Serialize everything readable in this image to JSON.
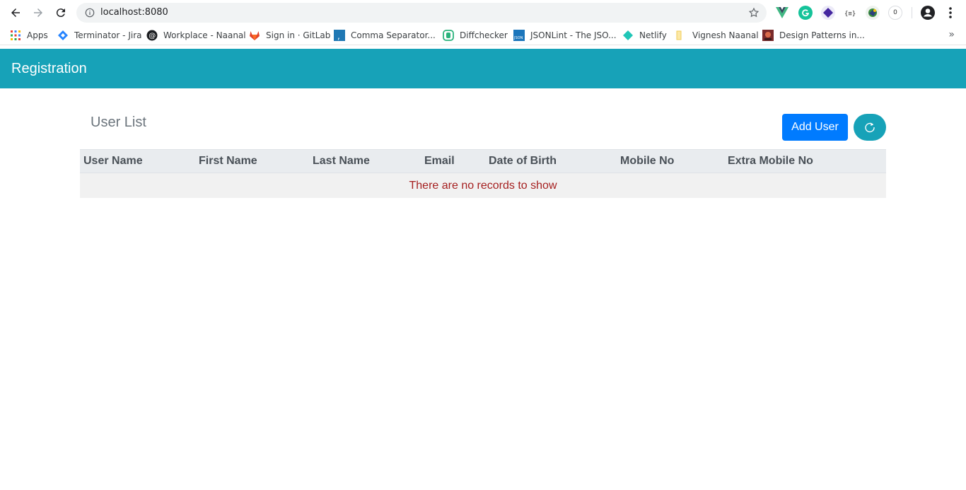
{
  "browser": {
    "url": "localhost:8080",
    "extension_badge": "0",
    "bookmarks": [
      {
        "label": "Apps",
        "icon": "apps-grid-icon"
      },
      {
        "label": "Terminator - Jira",
        "icon": "jira-icon"
      },
      {
        "label": "Workplace - Naanal",
        "icon": "workplace-icon"
      },
      {
        "label": "Sign in · GitLab",
        "icon": "gitlab-icon"
      },
      {
        "label": "Comma Separator...",
        "icon": "comma-icon"
      },
      {
        "label": "Diffchecker",
        "icon": "diffchecker-icon"
      },
      {
        "label": "JSONLint - The JSO...",
        "icon": "jsonlint-icon"
      },
      {
        "label": "Netlify",
        "icon": "netlify-icon"
      },
      {
        "label": "Vignesh Naanal",
        "icon": "folder-icon"
      },
      {
        "label": "Design Patterns in...",
        "icon": "design-patterns-icon"
      }
    ],
    "more_label": "»"
  },
  "app": {
    "title": "Registration",
    "accent_color": "#17a2b8",
    "primary_color": "#007bff"
  },
  "user_list": {
    "title": "User List",
    "add_button_label": "Add User",
    "refresh_icon": "refresh-icon",
    "columns": [
      "User Name",
      "First Name",
      "Last Name",
      "Email",
      "Date of Birth",
      "Mobile No",
      "Extra Mobile No"
    ],
    "empty_message": "There are no records to show"
  }
}
